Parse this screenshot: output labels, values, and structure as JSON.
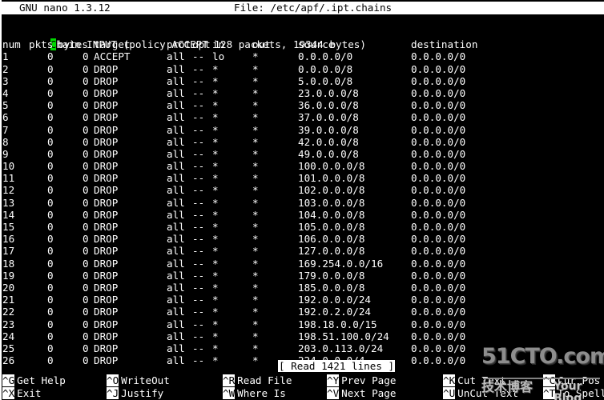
{
  "titlebar": {
    "app": "GNU nano 1.3.12",
    "file_label": "File: /etc/apf/.ipt.chains"
  },
  "editor": {
    "chain_header": "Chain INPUT (policy ACCEPT 128 packets, 19344 bytes)",
    "cursor_char": "C",
    "chain_header_rest": "hain INPUT (policy ACCEPT 128 packets, 19344 bytes)",
    "columns": {
      "num": "num",
      "pkts": "pkts",
      "bytes": "bytes",
      "target": "target",
      "prot": "prot",
      "opt": "opt",
      "in": "in",
      "out": "out",
      "source": "source",
      "destination": "destination"
    },
    "rules": [
      {
        "num": "1",
        "pkts": "0",
        "bytes": "0",
        "target": "ACCEPT",
        "prot": "all",
        "opt": "--",
        "in": "lo",
        "out": "*",
        "source": "0.0.0.0/0",
        "destination": "0.0.0.0/0"
      },
      {
        "num": "2",
        "pkts": "0",
        "bytes": "0",
        "target": "DROP",
        "prot": "all",
        "opt": "--",
        "in": "*",
        "out": "*",
        "source": "0.0.0.0/8",
        "destination": "0.0.0.0/0"
      },
      {
        "num": "3",
        "pkts": "0",
        "bytes": "0",
        "target": "DROP",
        "prot": "all",
        "opt": "--",
        "in": "*",
        "out": "*",
        "source": "5.0.0.0/8",
        "destination": "0.0.0.0/0"
      },
      {
        "num": "4",
        "pkts": "0",
        "bytes": "0",
        "target": "DROP",
        "prot": "all",
        "opt": "--",
        "in": "*",
        "out": "*",
        "source": "23.0.0.0/8",
        "destination": "0.0.0.0/0"
      },
      {
        "num": "5",
        "pkts": "0",
        "bytes": "0",
        "target": "DROP",
        "prot": "all",
        "opt": "--",
        "in": "*",
        "out": "*",
        "source": "36.0.0.0/8",
        "destination": "0.0.0.0/0"
      },
      {
        "num": "6",
        "pkts": "0",
        "bytes": "0",
        "target": "DROP",
        "prot": "all",
        "opt": "--",
        "in": "*",
        "out": "*",
        "source": "37.0.0.0/8",
        "destination": "0.0.0.0/0"
      },
      {
        "num": "7",
        "pkts": "0",
        "bytes": "0",
        "target": "DROP",
        "prot": "all",
        "opt": "--",
        "in": "*",
        "out": "*",
        "source": "39.0.0.0/8",
        "destination": "0.0.0.0/0"
      },
      {
        "num": "8",
        "pkts": "0",
        "bytes": "0",
        "target": "DROP",
        "prot": "all",
        "opt": "--",
        "in": "*",
        "out": "*",
        "source": "42.0.0.0/8",
        "destination": "0.0.0.0/0"
      },
      {
        "num": "9",
        "pkts": "0",
        "bytes": "0",
        "target": "DROP",
        "prot": "all",
        "opt": "--",
        "in": "*",
        "out": "*",
        "source": "49.0.0.0/8",
        "destination": "0.0.0.0/0"
      },
      {
        "num": "10",
        "pkts": "0",
        "bytes": "0",
        "target": "DROP",
        "prot": "all",
        "opt": "--",
        "in": "*",
        "out": "*",
        "source": "100.0.0.0/8",
        "destination": "0.0.0.0/0"
      },
      {
        "num": "11",
        "pkts": "0",
        "bytes": "0",
        "target": "DROP",
        "prot": "all",
        "opt": "--",
        "in": "*",
        "out": "*",
        "source": "101.0.0.0/8",
        "destination": "0.0.0.0/0"
      },
      {
        "num": "12",
        "pkts": "0",
        "bytes": "0",
        "target": "DROP",
        "prot": "all",
        "opt": "--",
        "in": "*",
        "out": "*",
        "source": "102.0.0.0/8",
        "destination": "0.0.0.0/0"
      },
      {
        "num": "13",
        "pkts": "0",
        "bytes": "0",
        "target": "DROP",
        "prot": "all",
        "opt": "--",
        "in": "*",
        "out": "*",
        "source": "103.0.0.0/8",
        "destination": "0.0.0.0/0"
      },
      {
        "num": "14",
        "pkts": "0",
        "bytes": "0",
        "target": "DROP",
        "prot": "all",
        "opt": "--",
        "in": "*",
        "out": "*",
        "source": "104.0.0.0/8",
        "destination": "0.0.0.0/0"
      },
      {
        "num": "15",
        "pkts": "0",
        "bytes": "0",
        "target": "DROP",
        "prot": "all",
        "opt": "--",
        "in": "*",
        "out": "*",
        "source": "105.0.0.0/8",
        "destination": "0.0.0.0/0"
      },
      {
        "num": "16",
        "pkts": "0",
        "bytes": "0",
        "target": "DROP",
        "prot": "all",
        "opt": "--",
        "in": "*",
        "out": "*",
        "source": "106.0.0.0/8",
        "destination": "0.0.0.0/0"
      },
      {
        "num": "17",
        "pkts": "0",
        "bytes": "0",
        "target": "DROP",
        "prot": "all",
        "opt": "--",
        "in": "*",
        "out": "*",
        "source": "127.0.0.0/8",
        "destination": "0.0.0.0/0"
      },
      {
        "num": "18",
        "pkts": "0",
        "bytes": "0",
        "target": "DROP",
        "prot": "all",
        "opt": "--",
        "in": "*",
        "out": "*",
        "source": "169.254.0.0/16",
        "destination": "0.0.0.0/0"
      },
      {
        "num": "19",
        "pkts": "0",
        "bytes": "0",
        "target": "DROP",
        "prot": "all",
        "opt": "--",
        "in": "*",
        "out": "*",
        "source": "179.0.0.0/8",
        "destination": "0.0.0.0/0"
      },
      {
        "num": "20",
        "pkts": "0",
        "bytes": "0",
        "target": "DROP",
        "prot": "all",
        "opt": "--",
        "in": "*",
        "out": "*",
        "source": "185.0.0.0/8",
        "destination": "0.0.0.0/0"
      },
      {
        "num": "21",
        "pkts": "0",
        "bytes": "0",
        "target": "DROP",
        "prot": "all",
        "opt": "--",
        "in": "*",
        "out": "*",
        "source": "192.0.0.0/24",
        "destination": "0.0.0.0/0"
      },
      {
        "num": "22",
        "pkts": "0",
        "bytes": "0",
        "target": "DROP",
        "prot": "all",
        "opt": "--",
        "in": "*",
        "out": "*",
        "source": "192.0.2.0/24",
        "destination": "0.0.0.0/0"
      },
      {
        "num": "23",
        "pkts": "0",
        "bytes": "0",
        "target": "DROP",
        "prot": "all",
        "opt": "--",
        "in": "*",
        "out": "*",
        "source": "198.18.0.0/15",
        "destination": "0.0.0.0/0"
      },
      {
        "num": "24",
        "pkts": "0",
        "bytes": "0",
        "target": "DROP",
        "prot": "all",
        "opt": "--",
        "in": "*",
        "out": "*",
        "source": "198.51.100.0/24",
        "destination": "0.0.0.0/0"
      },
      {
        "num": "25",
        "pkts": "0",
        "bytes": "0",
        "target": "DROP",
        "prot": "all",
        "opt": "--",
        "in": "*",
        "out": "*",
        "source": "203.0.113.0/24",
        "destination": "0.0.0.0/0"
      },
      {
        "num": "26",
        "pkts": "0",
        "bytes": "0",
        "target": "DROP",
        "prot": "all",
        "opt": "--",
        "in": "*",
        "out": "*",
        "source": "224.0.0.0/4",
        "destination": "0.0.0.0/0"
      }
    ]
  },
  "status": {
    "message": "[ Read 1421 lines ]"
  },
  "shortcuts": [
    {
      "key": "^G",
      "label": "Get Help"
    },
    {
      "key": "^O",
      "label": "WriteOut"
    },
    {
      "key": "^R",
      "label": "Read File"
    },
    {
      "key": "^Y",
      "label": "Prev Page"
    },
    {
      "key": "^K",
      "label": "Cut Text"
    },
    {
      "key": "^C",
      "label": "Cur Pos"
    },
    {
      "key": "^X",
      "label": "Exit"
    },
    {
      "key": "^J",
      "label": "Justify"
    },
    {
      "key": "^W",
      "label": "Where Is"
    },
    {
      "key": "^V",
      "label": "Next Page"
    },
    {
      "key": "^U",
      "label": "UnCut Text"
    },
    {
      "key": "^T",
      "label": "To Spell"
    }
  ],
  "watermark": {
    "main": "51CTO.com",
    "sub": "技术博客",
    "sub2": "Your Blog"
  },
  "colors": {
    "background": "#000000",
    "foreground": "#ffffff",
    "cursor": "#00d800",
    "inverse_bg": "#ffffff",
    "inverse_fg": "#000000"
  }
}
